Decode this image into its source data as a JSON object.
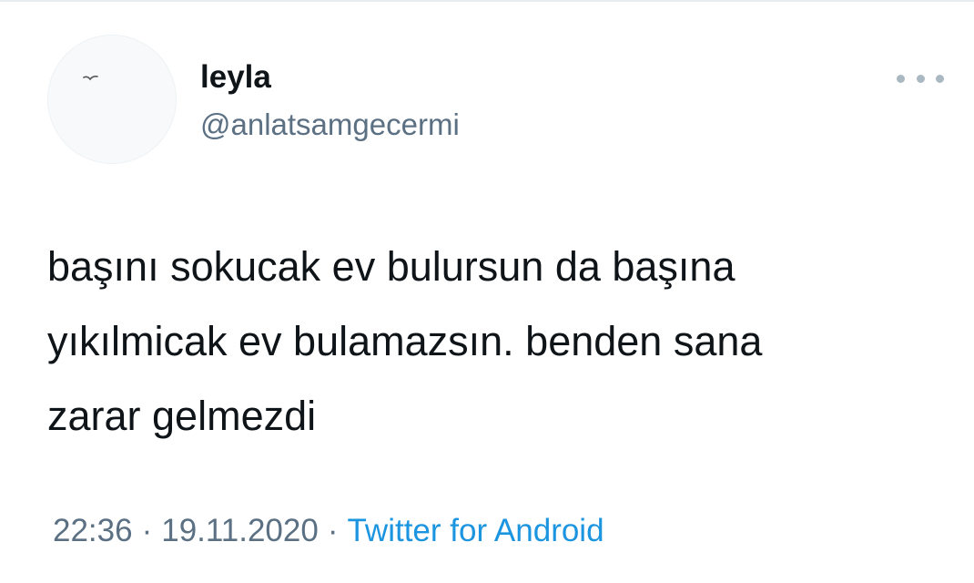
{
  "tweet": {
    "display_name": "leyla",
    "handle": "@anlatsamgecermi",
    "avatar_icon": "bird-icon",
    "more_icon": "more-options-icon",
    "text_lines": [
      "başını sokucak ev bulursun da başına",
      "yıkılmicak ev bulamazsın. benden sana",
      "zarar gelmezdi"
    ],
    "time": "22:36",
    "date": "19.11.2020",
    "source": "Twitter for Android",
    "separator": "·"
  },
  "colors": {
    "text": "#0f1419",
    "secondary": "#5b7083",
    "link": "#1b95e0",
    "divider": "#e6ecf0"
  }
}
